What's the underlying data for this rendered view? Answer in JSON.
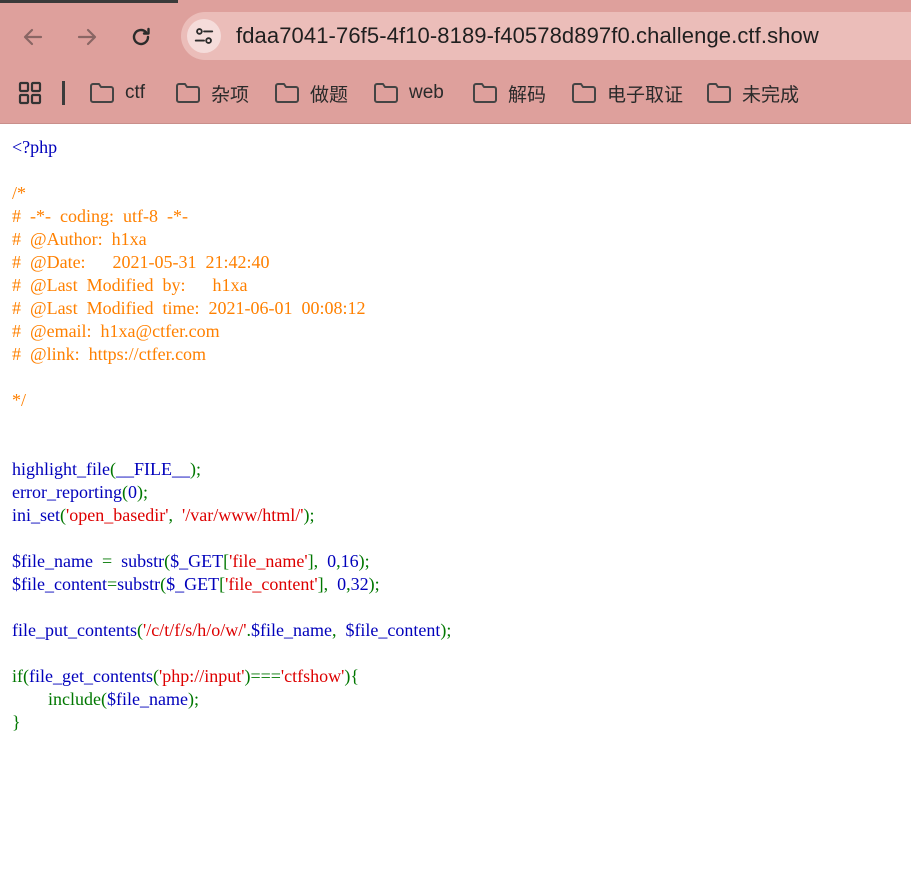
{
  "browser": {
    "url": "fdaa7041-76f5-4f10-8189-f40578d897f0.challenge.ctf.show",
    "back_icon": "arrow-left-icon",
    "forward_icon": "arrow-right-icon",
    "reload_icon": "reload-icon",
    "site_info_icon": "tune-icon"
  },
  "bookmarks": [
    "ctf",
    "杂项",
    "做题",
    "web",
    "解码",
    "电子取证",
    "未完成"
  ],
  "code": {
    "open_tag": "<?php",
    "comment_open": "/*",
    "comment_lines": [
      "#  -*-  coding:  utf-8  -*-",
      "#  @Author:  h1xa",
      "#  @Date:      2021-05-31  21:42:40",
      "#  @Last  Modified  by:      h1xa",
      "#  @Last  Modified  time:  2021-06-01  00:08:12",
      "#  @email:  h1xa@ctfer.com",
      "#  @link:  https://ctfer.com"
    ],
    "comment_close": "*/",
    "highlight_fn": "highlight_file",
    "file_const": "__FILE__",
    "error_fn": "error_reporting",
    "zero": "0",
    "ini_fn": "ini_set",
    "ini_key": "'open_basedir'",
    "ini_val": "'/var/www/html/'",
    "var_file_name": "$file_name",
    "var_file_content": "$file_content",
    "substr_fn": "substr",
    "get_var": "$_GET",
    "key_file_name": "'file_name'",
    "key_file_content": "'file_content'",
    "len16": "16",
    "len32": "32",
    "fpc_fn": "file_put_contents",
    "path": "'/c/t/f/s/h/o/w/'",
    "if_kw": "if",
    "fgc_fn": "file_get_contents",
    "php_input": "'php://input'",
    "ctfshow": "'ctfshow'",
    "include_kw": "include"
  },
  "colors": {
    "default": "#0000BB",
    "comment": "#FF8000",
    "keyword": "#007700",
    "string": "#DD0000",
    "chrome": "#DEA09C"
  }
}
